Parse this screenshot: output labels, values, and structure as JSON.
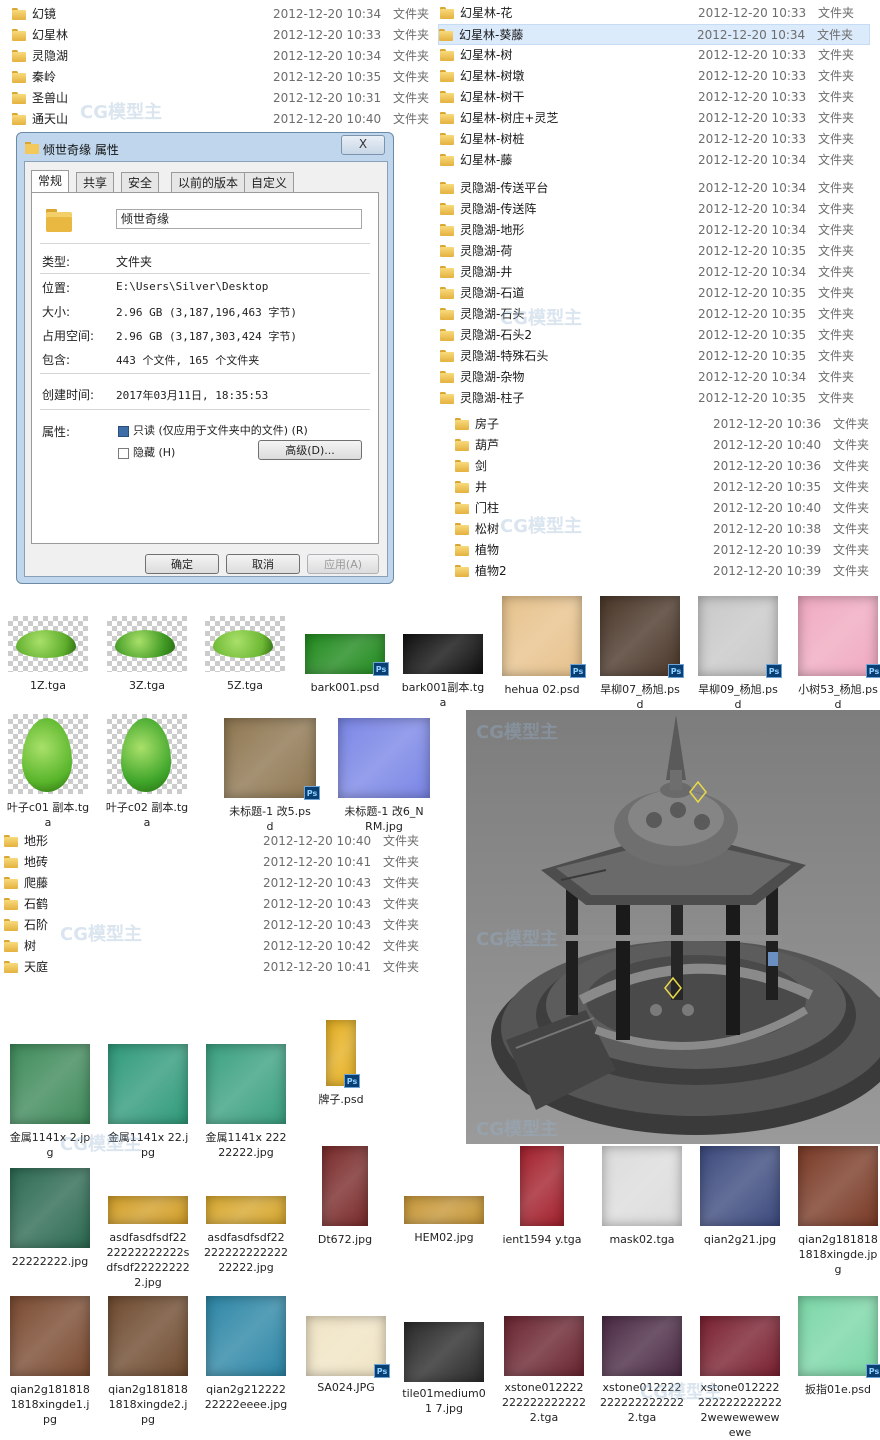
{
  "window_title": "倾世奇缘 属性",
  "close_label": "X",
  "tabs": [
    {
      "label": "常规"
    },
    {
      "label": "共享"
    },
    {
      "label": "安全"
    },
    {
      "label": "以前的版本"
    },
    {
      "label": "自定义"
    }
  ],
  "props": {
    "name_value": "倾世奇缘",
    "type_label": "类型:",
    "type_value": "文件夹",
    "location_label": "位置:",
    "location_value": "E:\\Users\\Silver\\Desktop",
    "size_label": "大小:",
    "size_value": "2.96 GB (3,187,196,463 字节)",
    "disk_label": "占用空间:",
    "disk_value": "2.96 GB (3,187,303,424 字节)",
    "contains_label": "包含:",
    "contains_value": "443 个文件, 165 个文件夹",
    "created_label": "创建时间:",
    "created_value": "2017年03月11日, 18:35:53",
    "attrs_label": "属性:",
    "readonly_label": "只读 (仅应用于文件夹中的文件) (R)",
    "hidden_label": "隐藏 (H)",
    "advanced_label": "高级(D)..."
  },
  "buttons": {
    "ok": "确定",
    "cancel": "取消",
    "apply": "应用(A)"
  },
  "list_a": [
    {
      "name": "幻镜",
      "date": "2012-12-20 10:34",
      "type": "文件夹"
    },
    {
      "name": "幻星林",
      "date": "2012-12-20 10:33",
      "type": "文件夹"
    },
    {
      "name": "灵隐湖",
      "date": "2012-12-20 10:34",
      "type": "文件夹"
    },
    {
      "name": "秦岭",
      "date": "2012-12-20 10:35",
      "type": "文件夹"
    },
    {
      "name": "圣兽山",
      "date": "2012-12-20 10:31",
      "type": "文件夹"
    },
    {
      "name": "通天山",
      "date": "2012-12-20 10:40",
      "type": "文件夹"
    }
  ],
  "list_b": [
    {
      "name": "幻星林-花",
      "date": "2012-12-20 10:33",
      "type": "文件夹"
    },
    {
      "name": "幻星林-葵藤",
      "date": "2012-12-20 10:34",
      "type": "文件夹",
      "selected": true
    },
    {
      "name": "幻星林-树",
      "date": "2012-12-20 10:33",
      "type": "文件夹"
    },
    {
      "name": "幻星林-树墩",
      "date": "2012-12-20 10:33",
      "type": "文件夹"
    },
    {
      "name": "幻星林-树干",
      "date": "2012-12-20 10:33",
      "type": "文件夹"
    },
    {
      "name": "幻星林-树庄+灵芝",
      "date": "2012-12-20 10:33",
      "type": "文件夹"
    },
    {
      "name": "幻星林-树桩",
      "date": "2012-12-20 10:33",
      "type": "文件夹"
    },
    {
      "name": "幻星林-藤",
      "date": "2012-12-20 10:34",
      "type": "文件夹"
    }
  ],
  "list_c": [
    {
      "name": "灵隐湖-传送平台",
      "date": "2012-12-20 10:34",
      "type": "文件夹"
    },
    {
      "name": "灵隐湖-传送阵",
      "date": "2012-12-20 10:34",
      "type": "文件夹"
    },
    {
      "name": "灵隐湖-地形",
      "date": "2012-12-20 10:34",
      "type": "文件夹"
    },
    {
      "name": "灵隐湖-荷",
      "date": "2012-12-20 10:35",
      "type": "文件夹"
    },
    {
      "name": "灵隐湖-井",
      "date": "2012-12-20 10:34",
      "type": "文件夹"
    },
    {
      "name": "灵隐湖-石道",
      "date": "2012-12-20 10:35",
      "type": "文件夹"
    },
    {
      "name": "灵隐湖-石头",
      "date": "2012-12-20 10:35",
      "type": "文件夹"
    },
    {
      "name": "灵隐湖-石头2",
      "date": "2012-12-20 10:35",
      "type": "文件夹"
    },
    {
      "name": "灵隐湖-特殊石头",
      "date": "2012-12-20 10:35",
      "type": "文件夹"
    },
    {
      "name": "灵隐湖-杂物",
      "date": "2012-12-20 10:34",
      "type": "文件夹"
    },
    {
      "name": "灵隐湖-柱子",
      "date": "2012-12-20 10:35",
      "type": "文件夹"
    }
  ],
  "list_d": [
    {
      "name": "房子",
      "date": "2012-12-20 10:36",
      "type": "文件夹"
    },
    {
      "name": "葫芦",
      "date": "2012-12-20 10:40",
      "type": "文件夹"
    },
    {
      "name": "剑",
      "date": "2012-12-20 10:36",
      "type": "文件夹"
    },
    {
      "name": "井",
      "date": "2012-12-20 10:35",
      "type": "文件夹"
    },
    {
      "name": "门柱",
      "date": "2012-12-20 10:40",
      "type": "文件夹"
    },
    {
      "name": "松树",
      "date": "2012-12-20 10:38",
      "type": "文件夹"
    },
    {
      "name": "植物",
      "date": "2012-12-20 10:39",
      "type": "文件夹"
    },
    {
      "name": "植物2",
      "date": "2012-12-20 10:39",
      "type": "文件夹"
    }
  ],
  "list_e": [
    {
      "name": "地形",
      "date": "2012-12-20 10:40",
      "type": "文件夹"
    },
    {
      "name": "地砖",
      "date": "2012-12-20 10:41",
      "type": "文件夹"
    },
    {
      "name": "爬藤",
      "date": "2012-12-20 10:43",
      "type": "文件夹"
    },
    {
      "name": "石鹤",
      "date": "2012-12-20 10:43",
      "type": "文件夹"
    },
    {
      "name": "石阶",
      "date": "2012-12-20 10:43",
      "type": "文件夹"
    },
    {
      "name": "树",
      "date": "2012-12-20 10:42",
      "type": "文件夹"
    },
    {
      "name": "天庭",
      "date": "2012-12-20 10:41",
      "type": "文件夹"
    }
  ],
  "thumbs": [
    {
      "label": "1Z.tga",
      "kind": "leafsmall",
      "color": "#5fae2c"
    },
    {
      "label": "3Z.tga",
      "kind": "leafsmall",
      "color": "#3f9a24"
    },
    {
      "label": "5Z.tga",
      "kind": "leafsmall",
      "color": "#6db834"
    },
    {
      "label": "bark001.psd",
      "kind": "tex",
      "color": "#1f8a1c",
      "ps": true
    },
    {
      "label": "bark001副本.tga",
      "kind": "tex",
      "color": "#111111"
    },
    {
      "label": "hehua 02.psd",
      "kind": "tex",
      "color": "#e7c28c",
      "ps": true
    },
    {
      "label": "旱柳07_杨旭.psd",
      "kind": "tex",
      "color": "#4a3628",
      "ps": true
    },
    {
      "label": "旱柳09_杨旭.psd",
      "kind": "tex",
      "color": "#c8c8c8",
      "ps": true
    },
    {
      "label": "小树53_杨旭.psd",
      "kind": "tex",
      "color": "#f0a9c0",
      "ps": true
    },
    {
      "label": "叶子c01 副本.tga",
      "kind": "leafbig",
      "color": "#58b52a"
    },
    {
      "label": "叶子c02 副本.tga",
      "kind": "leafbig",
      "color": "#3ea52a"
    },
    {
      "label": "未标题-1 改5.psd",
      "kind": "tex",
      "color": "#8e7650",
      "ps": true
    },
    {
      "label": "未标题-1 改6_NRM.jpg",
      "kind": "tex",
      "color": "#7a86e6"
    },
    {
      "label": "金属1141x 2.jpg",
      "kind": "tex",
      "color": "#3e8a5a"
    },
    {
      "label": "金属1141x 22.jpg",
      "kind": "tex",
      "color": "#2f9a7a"
    },
    {
      "label": "金属1141x 22222222.jpg",
      "kind": "tex",
      "color": "#3aa080"
    },
    {
      "label": "牌子.psd",
      "kind": "tex",
      "color": "#e6b020",
      "ps": true
    },
    {
      "label": "22222222.jpg",
      "kind": "tex",
      "color": "#2c6a52"
    },
    {
      "label": "asdfasdfsdf2222222222222sdfsdf222222222.jpg",
      "kind": "tex",
      "color": "#d4a028"
    },
    {
      "label": "asdfasdfsdf2222222222222222222.jpg",
      "kind": "tex",
      "color": "#d8a82e"
    },
    {
      "label": "Dt672.jpg",
      "kind": "tex",
      "color": "#7a2a2a"
    },
    {
      "label": "HEM02.jpg",
      "kind": "tex",
      "color": "#c89838"
    },
    {
      "label": "ient1594 y.tga",
      "kind": "tex",
      "color": "#a3202c"
    },
    {
      "label": "mask02.tga",
      "kind": "tex",
      "color": "#dcdcdc"
    },
    {
      "label": "qian2g21.jpg",
      "kind": "tex",
      "color": "#3c4a7e"
    },
    {
      "label": "qian2g1818181818xingde.jpg",
      "kind": "tex",
      "color": "#7a3a26"
    },
    {
      "label": "qian2g1818181818xingde1.jpg",
      "kind": "tex",
      "color": "#7a4a30"
    },
    {
      "label": "qian2g1818181818xingde2.jpg",
      "kind": "tex",
      "color": "#6e4a2e"
    },
    {
      "label": "qian2g21222222222eeee.jpg",
      "kind": "tex",
      "color": "#2c86a6"
    },
    {
      "label": "SA024.JPG",
      "kind": "tex",
      "color": "#f0e4c4",
      "ps": true
    },
    {
      "label": "tile01medium01 7.jpg",
      "kind": "tex",
      "color": "#2a2a2a"
    },
    {
      "label": "xstone0122222222222222222.tga",
      "kind": "tex",
      "color": "#6a2430"
    },
    {
      "label": "xstone0122222222222222222.tga",
      "kind": "tex",
      "color": "#4a2a44"
    },
    {
      "label": "xstone0122222222222222222wewewewewewe",
      "kind": "tex",
      "color": "#7a2030"
    },
    {
      "label": "扳指01e.psd",
      "kind": "tex",
      "color": "#7ad6a6",
      "ps": true
    }
  ],
  "watermark": "CG模型主",
  "colors": {
    "folder": "#e8b844",
    "selection": "#dcebfc",
    "dialog_frame": "#bfd6ec",
    "viewport_bg": "#8c8c8c"
  }
}
